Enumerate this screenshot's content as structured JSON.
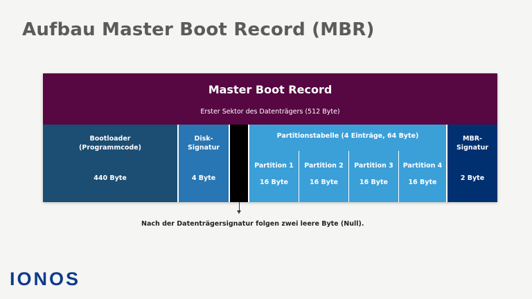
{
  "page": {
    "title": "Aufbau Master Boot Record (MBR)"
  },
  "mbr": {
    "title": "Master Boot Record",
    "subtitle": "Erster Sektor des Datenträgers (512 Byte)"
  },
  "segments": {
    "bootloader": {
      "label": "Bootloader\n(Programmcode)",
      "size": "440 Byte"
    },
    "disk_signature": {
      "label": "Disk-Signatur",
      "size": "4 Byte"
    },
    "partition_table": {
      "label": "Partitionstabelle (4 Einträge, 64 Byte)",
      "partitions": [
        {
          "label": "Partition 1",
          "size": "16 Byte"
        },
        {
          "label": "Partition 2",
          "size": "16 Byte"
        },
        {
          "label": "Partition 3",
          "size": "16 Byte"
        },
        {
          "label": "Partition 4",
          "size": "16 Byte"
        }
      ]
    },
    "mbr_signature": {
      "label": "MBR-\nSignatur",
      "size": "2 Byte"
    }
  },
  "note": "Nach der Datenträgersignatur folgen zwei leere Byte (Null).",
  "logo": "IONOS",
  "colors": {
    "header": "#570742",
    "bootloader": "#1c4d72",
    "disk_signature": "#2876b3",
    "null_bytes": "#000000",
    "partition_table": "#3b9fd8",
    "mbr_signature": "#003070",
    "logo": "#0d3a8c"
  }
}
